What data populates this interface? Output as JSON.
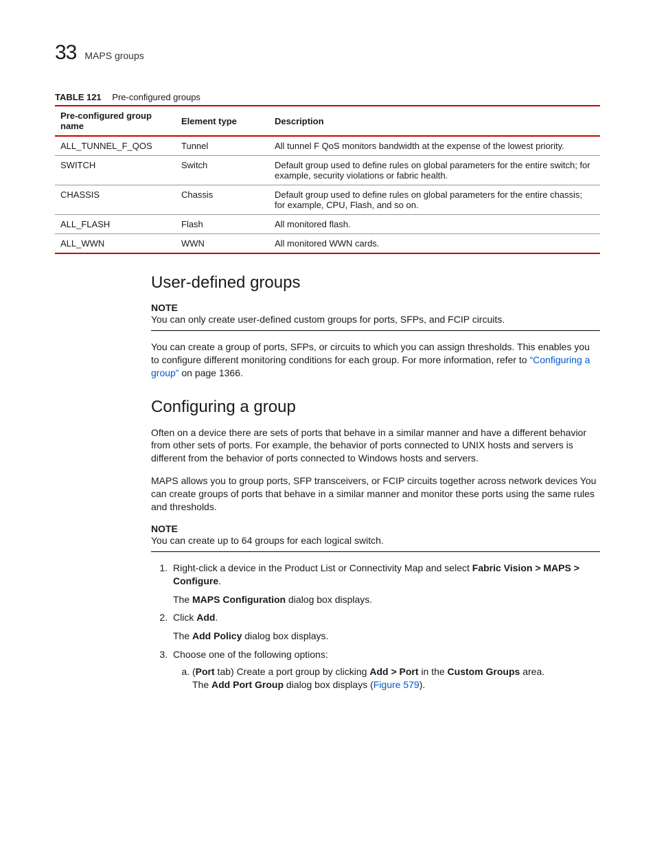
{
  "header": {
    "chapter_number": "33",
    "chapter_title": "MAPS groups"
  },
  "table": {
    "caption_label": "TABLE 121",
    "caption_text": "Pre-configured groups",
    "columns": [
      "Pre-configured group name",
      "Element type",
      "Description"
    ],
    "rows": [
      {
        "name": "ALL_TUNNEL_F_QOS",
        "type": "Tunnel",
        "desc": "All tunnel F QoS monitors bandwidth at the expense of the lowest priority."
      },
      {
        "name": "SWITCH",
        "type": "Switch",
        "desc": "Default group used to define rules on global parameters for the entire switch; for example, security violations or fabric health."
      },
      {
        "name": "CHASSIS",
        "type": "Chassis",
        "desc": "Default group used to define rules on global parameters for the entire chassis; for example, CPU, Flash, and so on."
      },
      {
        "name": "ALL_FLASH",
        "type": "Flash",
        "desc": "All monitored flash."
      },
      {
        "name": "ALL_WWN",
        "type": "WWN",
        "desc": "All monitored WWN cards."
      }
    ]
  },
  "sections": {
    "udg": {
      "heading": "User-defined groups",
      "note_label": "NOTE",
      "note_text": "You can only create user-defined custom groups for ports, SFPs, and FCIP circuits.",
      "para_pre": "You can create a group of ports, SFPs, or circuits to which you can assign thresholds. This enables you to configure different monitoring conditions for each group. For more information, refer to ",
      "para_link": "“Configuring a group”",
      "para_post": " on page 1366."
    },
    "cfg": {
      "heading": "Configuring a group",
      "p1": "Often on a device there are sets of ports that behave in a similar manner and have a different behavior from other sets of ports. For example, the behavior of ports connected to UNIX hosts and servers is different from the behavior of ports connected to Windows hosts and servers.",
      "p2": "MAPS allows you to group ports, SFP transceivers, or FCIP circuits together across network devices You can create groups of ports that behave in a similar manner and monitor these ports using the same rules and thresholds.",
      "note_label": "NOTE",
      "note_text": "You can create up to 64 groups for each logical switch.",
      "s1_a": "Right-click a device in the Product List or Connectivity Map and select ",
      "s1_b": "Fabric Vision > MAPS > Configure",
      "s1_c": ".",
      "s1_after_a": "The ",
      "s1_after_b": "MAPS Configuration",
      "s1_after_c": " dialog box displays.",
      "s2_a": "Click ",
      "s2_b": "Add",
      "s2_c": ".",
      "s2_after_a": "The ",
      "s2_after_b": "Add Policy",
      "s2_after_c": " dialog box displays.",
      "s3": "Choose one of the following options:",
      "s3a_a": "(",
      "s3a_b": "Port",
      "s3a_c": " tab) Create a port group by clicking ",
      "s3a_d": "Add > Port",
      "s3a_e": " in the ",
      "s3a_f": "Custom Groups",
      "s3a_g": " area.",
      "s3a_after_a": "The ",
      "s3a_after_b": "Add Port Group",
      "s3a_after_c": " dialog box displays (",
      "s3a_after_link": "Figure 579",
      "s3a_after_d": ")."
    }
  }
}
